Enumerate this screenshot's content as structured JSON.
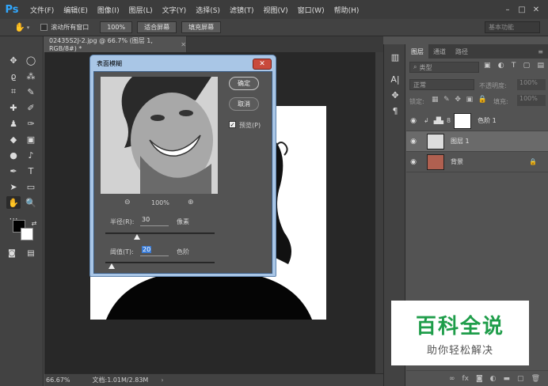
{
  "app": {
    "logo": "Ps"
  },
  "menu": [
    "文件(F)",
    "编辑(E)",
    "图像(I)",
    "图层(L)",
    "文字(Y)",
    "选择(S)",
    "滤镜(T)",
    "视图(V)",
    "窗口(W)",
    "帮助(H)"
  ],
  "window_controls": [
    "–",
    "□",
    "✕"
  ],
  "options": {
    "scroll_all_label": "滚动所有窗口",
    "zoom_value": "100%",
    "fit_screen_label": "适合屏幕",
    "fill_screen_label": "填充屏幕",
    "workspace": "基本功能"
  },
  "document": {
    "tab_title": "02435S2J-2.jpg @ 66.7% (图层 1, RGB/8#) *",
    "close": "✕"
  },
  "status": {
    "zoom": "66.67%",
    "doc_info": "文档:1.01M/2.83M"
  },
  "layers_panel": {
    "tabs": [
      "图层",
      "通道",
      "路径"
    ],
    "filter_label": "类型",
    "blend_mode": "正常",
    "opacity_label": "不透明度:",
    "opacity_value": "100%",
    "lock_label": "锁定:",
    "fill_label": "填充:",
    "fill_value": "100%",
    "layers": [
      {
        "name": "色阶 1"
      },
      {
        "name": "图层 1"
      },
      {
        "name": "背景"
      }
    ]
  },
  "dialog": {
    "title": "表面模糊",
    "ok_label": "确定",
    "cancel_label": "取消",
    "preview_label": "预览(P)",
    "preview_zoom": "100%",
    "radius_label": "半径(R):",
    "radius_value": "30",
    "radius_unit": "像素",
    "threshold_label": "阈值(T):",
    "threshold_value": "20",
    "threshold_unit": "色阶"
  },
  "watermark": {
    "title": "百科全说",
    "subtitle": "助你轻松解决"
  },
  "colors": {
    "menubar": "#3c3c3c",
    "panel": "#535353",
    "dialog_frame": "#a9c6e6",
    "watermark_green": "#1f9d4a"
  }
}
